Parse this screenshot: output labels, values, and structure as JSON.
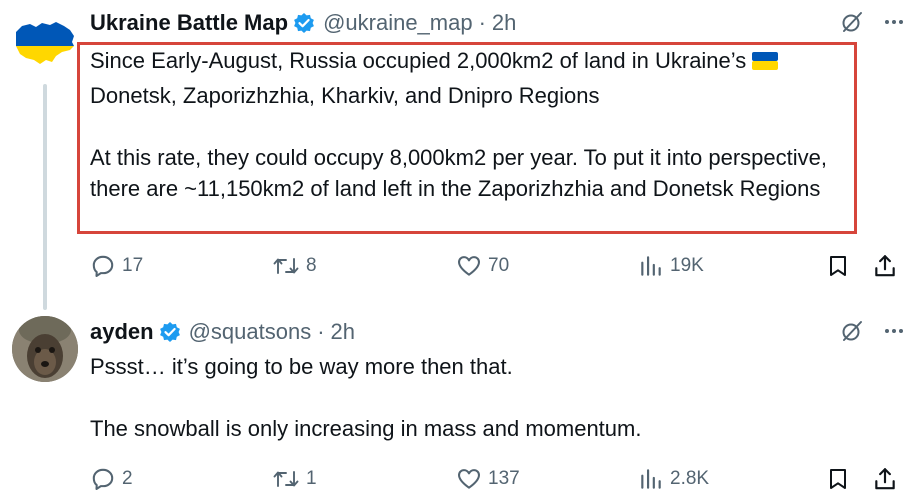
{
  "tweet1": {
    "display_name": "Ukraine Battle Map",
    "handle": "@ukraine_map",
    "separator": "·",
    "time": "2h",
    "para1": "Since Early-August, Russia occupied 2,000km2 of land in Ukraine’s",
    "para1_line2": "Donetsk, Zaporizhzhia, Kharkiv, and Dnipro Regions",
    "para2": "At this rate, they could occupy 8,000km2 per year. To put it into perspective, there are ~11,150km2 of land left in the Zaporizhzhia and Donetsk Regions",
    "replies": "17",
    "reposts": "8",
    "likes": "70",
    "views": "19K"
  },
  "tweet2": {
    "display_name": "ayden",
    "handle": "@squatsons",
    "separator": "·",
    "time": "2h",
    "para1": "Pssst… it’s going to be way more then that.",
    "para2": "The snowball is only increasing in mass and momentum.",
    "replies": "2",
    "reposts": "1",
    "likes": "137",
    "views": "2.8K"
  },
  "colors": {
    "text": "#0f1419",
    "secondary": "#536471",
    "verified_blue": "#1d9bf0",
    "highlight_border": "#d6453b",
    "flag_blue": "#0057b7",
    "flag_yellow": "#ffd700"
  },
  "icons": [
    "grok-icon",
    "more-icon",
    "reply-icon",
    "repost-icon",
    "like-icon",
    "views-icon",
    "bookmark-icon",
    "share-icon",
    "verified-badge-icon",
    "ukraine-flag-icon"
  ]
}
